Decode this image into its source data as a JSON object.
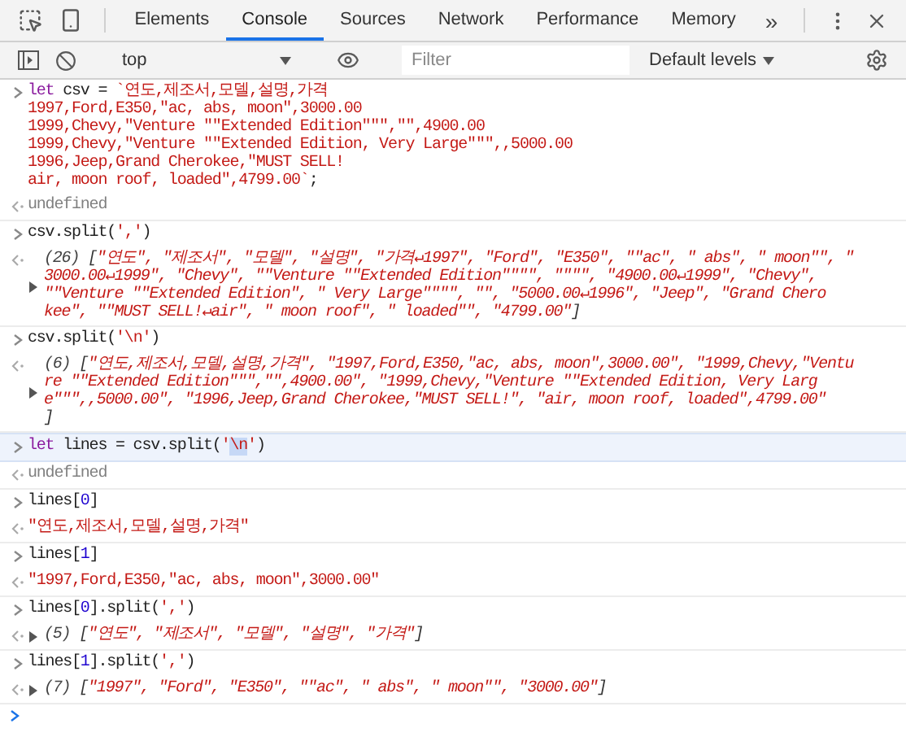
{
  "toolbar": {
    "tabs": [
      {
        "label": "Elements",
        "selected": false
      },
      {
        "label": "Console",
        "selected": true
      },
      {
        "label": "Sources",
        "selected": false
      },
      {
        "label": "Network",
        "selected": false
      },
      {
        "label": "Performance",
        "selected": false
      },
      {
        "label": "Memory",
        "selected": false
      }
    ],
    "more": "»"
  },
  "filter_bar": {
    "context": "top",
    "filter": {
      "placeholder": "Filter"
    },
    "levels": "Default levels"
  },
  "console": [
    {
      "kind": "input",
      "highlighted": false,
      "lines": [
        [
          {
            "kind": "keyword",
            "text": "let"
          },
          {
            "kind": "plain",
            "text": " csv = "
          },
          {
            "kind": "string",
            "text": "`연도,제조서,모델,설명,가격"
          }
        ],
        [
          {
            "kind": "string",
            "text": "1997,Ford,E350,\"ac, abs, moon\",3000.00"
          }
        ],
        [
          {
            "kind": "string",
            "text": "1999,Chevy,\"Venture \"\"Extended Edition\"\"\",\"\",4900.00"
          }
        ],
        [
          {
            "kind": "string",
            "text": "1999,Chevy,\"Venture \"\"Extended Edition, Very Large\"\"\",,5000.00"
          }
        ],
        [
          {
            "kind": "string",
            "text": "1996,Jeep,Grand Cherokee,\"MUST SELL!"
          }
        ],
        [
          {
            "kind": "string",
            "text": "air, moon roof, loaded\",4799.00`"
          },
          {
            "kind": "plain",
            "text": ";"
          }
        ]
      ]
    },
    {
      "kind": "result",
      "highlighted": false,
      "lines": [
        [
          {
            "kind": "undefined",
            "text": "undefined"
          }
        ]
      ]
    },
    {
      "kind": "input",
      "highlighted": false,
      "lines": [
        [
          {
            "kind": "plain",
            "text": "csv.split("
          },
          {
            "kind": "string",
            "text": "','"
          },
          {
            "kind": "plain",
            "text": ")"
          }
        ]
      ]
    },
    {
      "kind": "result",
      "highlighted": false,
      "expanded": false,
      "lines": [
        [
          {
            "kind": "count",
            "text": "(26) "
          },
          {
            "kind": "punct",
            "text": "["
          },
          {
            "kind": "item",
            "text": "\"연도\", \"제조서\", \"모델\", \"설명\", \"가격↵1997\", \"Ford\", \"E350\", \"\"ac\", \" abs\", \" moon\"\", \""
          }
        ],
        [
          {
            "kind": "item",
            "text": "3000.00↵1999\", \"Chevy\", \"\"Venture \"\"Extended Edition\"\"\"\", \"\"\"\", \"4900.00↵1999\", \"Chevy\","
          }
        ],
        [
          {
            "kind": "item",
            "text": "\"\"Venture \"\"Extended Edition\", \" Very Large\"\"\"\", \"\", \"5000.00↵1996\", \"Jeep\", \"Grand Chero"
          }
        ],
        [
          {
            "kind": "item",
            "text": "kee\", \"\"MUST SELL!↵air\", \" moon roof\", \" loaded\"\", \"4799.00\""
          },
          {
            "kind": "punct",
            "text": "]"
          }
        ]
      ]
    },
    {
      "kind": "input",
      "highlighted": false,
      "lines": [
        [
          {
            "kind": "plain",
            "text": "csv.split("
          },
          {
            "kind": "string",
            "text": "'\\n'"
          },
          {
            "kind": "plain",
            "text": ")"
          }
        ]
      ]
    },
    {
      "kind": "result",
      "highlighted": false,
      "expanded": false,
      "lines": [
        [
          {
            "kind": "count",
            "text": "(6) "
          },
          {
            "kind": "punct",
            "text": "["
          },
          {
            "kind": "item",
            "text": "\"연도,제조서,모델,설명,가격\", \"1997,Ford,E350,\"ac, abs, moon\",3000.00\", \"1999,Chevy,\"Ventu"
          }
        ],
        [
          {
            "kind": "item",
            "text": "re \"\"Extended Edition\"\"\",\"\",4900.00\", \"1999,Chevy,\"Venture \"\"Extended Edition, Very Larg"
          }
        ],
        [
          {
            "kind": "item",
            "text": "e\"\"\",,5000.00\", \"1996,Jeep,Grand Cherokee,\"MUST SELL!\", \"air, moon roof, loaded\",4799.00\""
          }
        ],
        [
          {
            "kind": "punct",
            "text": "]"
          }
        ]
      ]
    },
    {
      "kind": "input",
      "highlighted": true,
      "lines": [
        [
          {
            "kind": "keyword",
            "text": "let"
          },
          {
            "kind": "plain",
            "text": " lines = csv.split("
          },
          {
            "kind": "string",
            "text": "'"
          },
          {
            "kind": "selection",
            "text": "\\n"
          },
          {
            "kind": "string",
            "text": "'"
          },
          {
            "kind": "plain",
            "text": ")"
          }
        ]
      ]
    },
    {
      "kind": "result",
      "highlighted": false,
      "lines": [
        [
          {
            "kind": "undefined",
            "text": "undefined"
          }
        ]
      ]
    },
    {
      "kind": "input",
      "highlighted": false,
      "lines": [
        [
          {
            "kind": "plain",
            "text": "lines["
          },
          {
            "kind": "number",
            "text": "0"
          },
          {
            "kind": "plain",
            "text": "]"
          }
        ]
      ]
    },
    {
      "kind": "result",
      "highlighted": false,
      "lines": [
        [
          {
            "kind": "string",
            "text": "\"연도,제조서,모델,설명,가격\""
          }
        ]
      ]
    },
    {
      "kind": "input",
      "highlighted": false,
      "lines": [
        [
          {
            "kind": "plain",
            "text": "lines["
          },
          {
            "kind": "number",
            "text": "1"
          },
          {
            "kind": "plain",
            "text": "]"
          }
        ]
      ]
    },
    {
      "kind": "result",
      "highlighted": false,
      "lines": [
        [
          {
            "kind": "string",
            "text": "\"1997,Ford,E350,\"ac, abs, moon\",3000.00\""
          }
        ]
      ]
    },
    {
      "kind": "input",
      "highlighted": false,
      "lines": [
        [
          {
            "kind": "plain",
            "text": "lines["
          },
          {
            "kind": "number",
            "text": "0"
          },
          {
            "kind": "plain",
            "text": "].split("
          },
          {
            "kind": "string",
            "text": "','"
          },
          {
            "kind": "plain",
            "text": ")"
          }
        ]
      ]
    },
    {
      "kind": "result",
      "highlighted": false,
      "expanded": false,
      "lines": [
        [
          {
            "kind": "count",
            "text": "(5) "
          },
          {
            "kind": "punct",
            "text": "["
          },
          {
            "kind": "item",
            "text": "\"연도\", \"제조서\", \"모델\", \"설명\", \"가격\""
          },
          {
            "kind": "punct",
            "text": "]"
          }
        ]
      ]
    },
    {
      "kind": "input",
      "highlighted": false,
      "lines": [
        [
          {
            "kind": "plain",
            "text": "lines["
          },
          {
            "kind": "number",
            "text": "1"
          },
          {
            "kind": "plain",
            "text": "].split("
          },
          {
            "kind": "string",
            "text": "','"
          },
          {
            "kind": "plain",
            "text": ")"
          }
        ]
      ]
    },
    {
      "kind": "result",
      "highlighted": false,
      "expanded": false,
      "lines": [
        [
          {
            "kind": "count",
            "text": "(7) "
          },
          {
            "kind": "punct",
            "text": "["
          },
          {
            "kind": "item",
            "text": "\"1997\", \"Ford\", \"E350\", \"\"ac\", \" abs\", \" moon\"\", \"3000.00\""
          },
          {
            "kind": "punct",
            "text": "]"
          }
        ]
      ]
    }
  ]
}
